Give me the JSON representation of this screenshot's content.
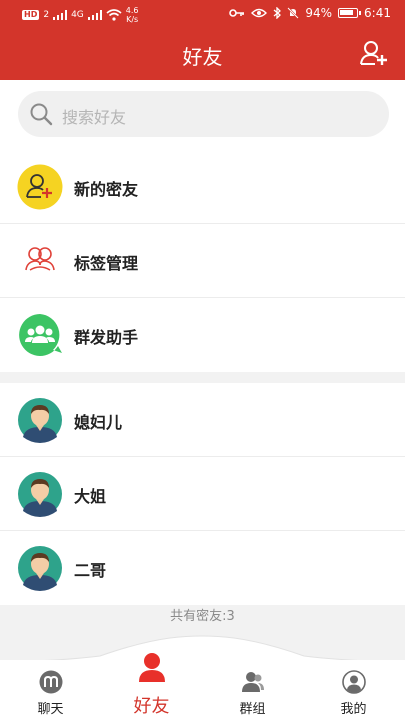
{
  "status_bar": {
    "network_badge": "HD",
    "network_num": "2",
    "network_gen": "4G",
    "speed_top": "4.6",
    "speed_unit": "K/s",
    "battery_percent": "94%",
    "battery_level": 0.94,
    "time": "6:41"
  },
  "header": {
    "title": "好友",
    "add_friend_icon": "add-friend-icon"
  },
  "search": {
    "placeholder": "搜索好友",
    "icon": "search-icon"
  },
  "functions": [
    {
      "label": "新的密友",
      "icon": "new-friend-icon",
      "color": "#f5d322"
    },
    {
      "label": "标签管理",
      "icon": "tag-manage-icon",
      "color": "#e0433a"
    },
    {
      "label": "群发助手",
      "icon": "group-send-icon",
      "color": "#3cc464"
    }
  ],
  "friends": [
    {
      "name": "媳妇儿",
      "avatar": "avatar-icon"
    },
    {
      "name": "大姐",
      "avatar": "avatar-icon"
    },
    {
      "name": "二哥",
      "avatar": "avatar-icon"
    }
  ],
  "friend_count": "共有密友:3",
  "tabs": [
    {
      "label": "聊天",
      "icon": "chat-m-icon",
      "active": false
    },
    {
      "label": "好友",
      "icon": "friends-icon",
      "active": true
    },
    {
      "label": "群组",
      "icon": "group-icon",
      "active": false
    },
    {
      "label": "我的",
      "icon": "profile-icon",
      "active": false
    }
  ],
  "colors": {
    "primary": "#d3352b",
    "background": "#f2f2f2"
  }
}
